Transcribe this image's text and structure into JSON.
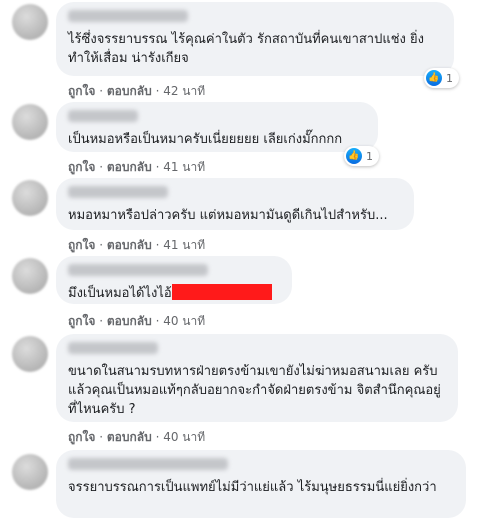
{
  "comments": [
    {
      "text": "ไร้ซึ่งจรรยาบรรณ ไร้คุณค่าในตัว รักสถาบันที่คนเขาสาปแช่ง ยิ่งทำให้เสื่อม น่ารังเกียจ",
      "like": "ถูกใจ",
      "reply": "ตอบกลับ",
      "time": "42 นาที",
      "reactions": "1"
    },
    {
      "text": "เป็นหมอหรือเป็นหมาครับเนี่ยยยยย เลียเก่งมั๊กกกก",
      "like": "ถูกใจ",
      "reply": "ตอบกลับ",
      "time": "41 นาที",
      "reactions": "1"
    },
    {
      "text": "หมอหมาหรือปล่าวครับ แต่หมอหมามันดูดีเกินไปสำหรับ...",
      "like": "ถูกใจ",
      "reply": "ตอบกลับ",
      "time": "41 นาที"
    },
    {
      "text": "มึงเป็นหมอได้ไงไอ้",
      "like": "ถูกใจ",
      "reply": "ตอบกลับ",
      "time": "40 นาที"
    },
    {
      "text": "ขนาดในสนามรบทหารฝ่ายตรงข้ามเขายังไม่ฆ่าหมอสนามเลย ครับ แล้วคุณเป็นหมอแท้ๆกลับอยากจะกำจัดฝ่ายตรงข้าม จิตสำนึกคุณอยู่ที่ไหนครับ ?",
      "like": "ถูกใจ",
      "reply": "ตอบกลับ",
      "time": "40 นาที"
    },
    {
      "text": "จรรยาบรรณการเป็นแพทย์ไม่มีว่าแย่แล้ว ไร้มนุษยธรรมนี่แย่ยิ่งกว่า"
    }
  ],
  "sep": "·"
}
